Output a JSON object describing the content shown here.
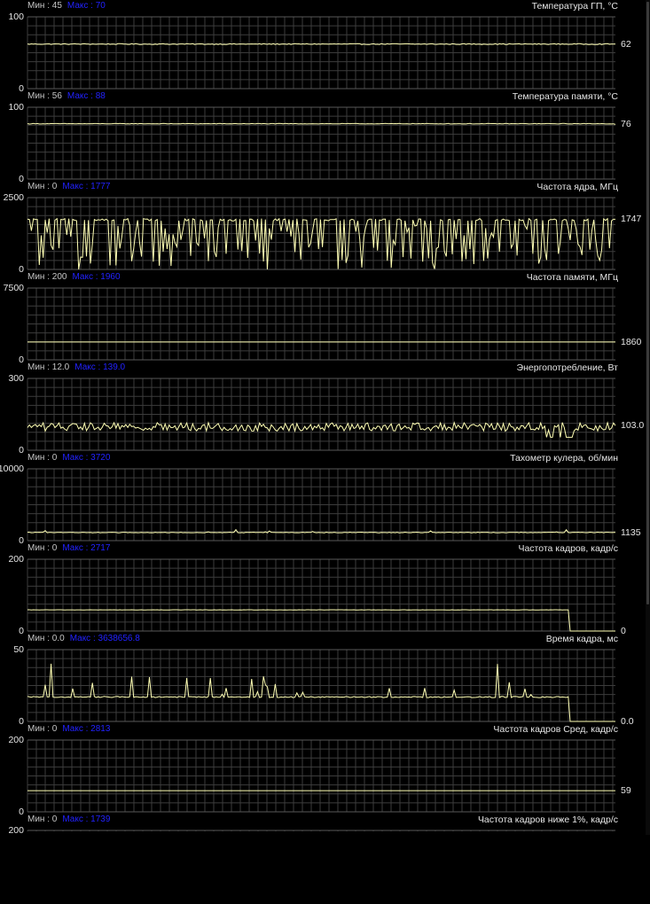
{
  "window": {
    "title": ""
  },
  "colors": {
    "background": "#000000",
    "grid": "#3c3c3c",
    "gridMajor": "#585858",
    "trace": "#ffffb4",
    "minText": "#c6c6c6",
    "maxText": "#2222ff",
    "label": "#e6e6e6"
  },
  "panels": [
    {
      "id": "gpu-temp",
      "title": "Температура ГП, °C",
      "min_text": "Мин : 45",
      "max_text": "Макс : 70",
      "y_max_label": "100",
      "y_min_label": "0",
      "current": "62",
      "y_range": [
        0,
        100
      ],
      "series": {
        "kind": "flat",
        "value": 62,
        "noise": 0.6,
        "end_value": 62
      }
    },
    {
      "id": "mem-temp",
      "title": "Температура памяти, °C",
      "min_text": "Мин : 56",
      "max_text": "Макс : 88",
      "y_max_label": "100",
      "y_min_label": "0",
      "current": "76",
      "y_range": [
        0,
        100
      ],
      "series": {
        "kind": "flat",
        "value": 77,
        "noise": 0.4,
        "end_value": 76
      }
    },
    {
      "id": "core-clock",
      "title": "Частота ядра, МГц",
      "min_text": "Мин : 0",
      "max_text": "Макс : 1777",
      "y_max_label": "2500",
      "y_min_label": "0",
      "current": "1747",
      "y_range": [
        0,
        2500
      ],
      "series": {
        "kind": "dips",
        "value": 1730,
        "noise": 40,
        "dip_prob": 0.45,
        "dip_min": 0,
        "end_value": 1747
      }
    },
    {
      "id": "mem-clock",
      "title": "Частота памяти, МГц",
      "min_text": "Мин : 200",
      "max_text": "Макс : 1960",
      "y_max_label": "7500",
      "y_min_label": "0",
      "current": "1860",
      "y_range": [
        0,
        7500
      ],
      "series": {
        "kind": "flat",
        "value": 1860,
        "noise": 0,
        "end_value": 1860
      }
    },
    {
      "id": "power",
      "title": "Энергопотребление, Вт",
      "min_text": "Мин : 12.0",
      "max_text": "Макс : 139.0",
      "y_max_label": "300",
      "y_min_label": "0",
      "current": "103.0",
      "y_range": [
        0,
        300
      ],
      "series": {
        "kind": "noisy",
        "value": 98,
        "noise": 18,
        "end_value": 103
      }
    },
    {
      "id": "fan-rpm",
      "title": "Тахометр кулера, об/мин",
      "min_text": "Мин : 0",
      "max_text": "Макс : 3720",
      "y_max_label": "10000",
      "y_min_label": "0",
      "current": "1135",
      "y_range": [
        0,
        10000
      ],
      "series": {
        "kind": "flat",
        "value": 1130,
        "noise": 40,
        "bump_prob": 0.03,
        "bump": 500,
        "end_value": 1135
      }
    },
    {
      "id": "fps",
      "title": "Частота кадров, кадр/с",
      "min_text": "Мин : 0",
      "max_text": "Макс : 2717",
      "y_max_label": "200",
      "y_min_label": "0",
      "current": "0",
      "y_range": [
        0,
        200
      ],
      "series": {
        "kind": "step",
        "value": 59,
        "noise": 0.3,
        "drop_at": 0.922,
        "end_value": 0
      }
    },
    {
      "id": "frametime",
      "title": "Время кадра, мс",
      "min_text": "Мин : 0.0",
      "max_text": "Макс : 3638656.8",
      "y_max_label": "50",
      "y_min_label": "0",
      "current": "0.0",
      "y_range": [
        0,
        50
      ],
      "series": {
        "kind": "spikes",
        "value": 17,
        "noise": 0.4,
        "spike_prob": 0.12,
        "spike_max": 33,
        "drop_at": 0.922,
        "end_value": 0
      }
    },
    {
      "id": "fps-avg",
      "title": "Частота кадров Сред, кадр/с",
      "min_text": "Мин : 0",
      "max_text": "Макс : 2813",
      "y_max_label": "200",
      "y_min_label": "0",
      "current": "59",
      "y_range": [
        0,
        200
      ],
      "series": {
        "kind": "flat",
        "value": 59,
        "noise": 0,
        "end_value": 59
      }
    },
    {
      "id": "fps-1low",
      "title": "Частота кадров ниже 1%, кадр/с",
      "min_text": "Мин : 0",
      "max_text": "Макс : 1739",
      "y_max_label": "200",
      "y_min_label": "",
      "current": "",
      "y_range": [
        0,
        200
      ],
      "series": {
        "kind": "none"
      }
    }
  ]
}
